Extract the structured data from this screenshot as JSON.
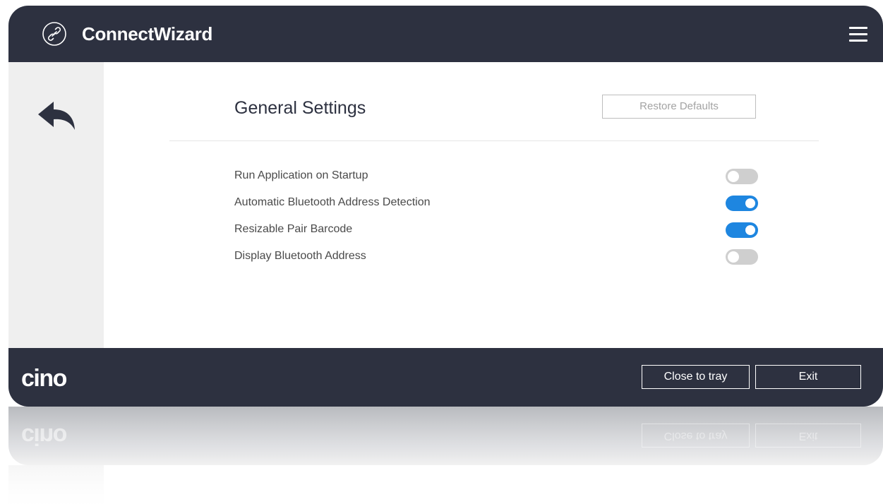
{
  "app": {
    "title": "ConnectWizard",
    "logo_icon": "link-circle-icon",
    "menu_icon": "hamburger-menu-icon"
  },
  "sidebar": {
    "back_icon": "reply-arrow-icon"
  },
  "settings": {
    "title": "General Settings",
    "restore_label": "Restore Defaults",
    "items": [
      {
        "label": "Run Application on Startup",
        "enabled": false
      },
      {
        "label": "Automatic Bluetooth Address Detection",
        "enabled": true
      },
      {
        "label": "Resizable Pair Barcode",
        "enabled": true
      },
      {
        "label": "Display Bluetooth Address",
        "enabled": false
      }
    ]
  },
  "footer": {
    "brand": "cino",
    "close_to_tray_label": "Close to tray",
    "exit_label": "Exit"
  },
  "colors": {
    "titlebar": "#2d3140",
    "toggle_on": "#1e86e0",
    "toggle_off": "#cfcfcf",
    "sidebar": "#efefef"
  }
}
